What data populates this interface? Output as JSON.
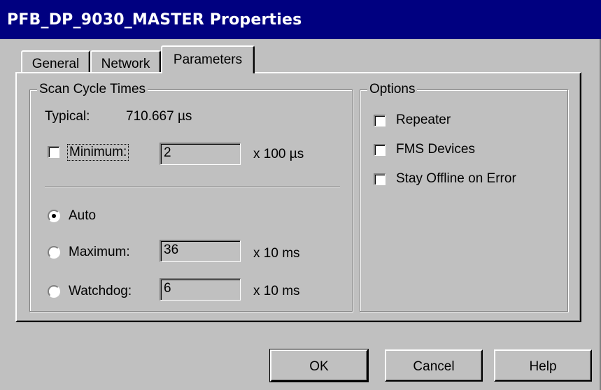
{
  "window": {
    "title": "PFB_DP_9030_MASTER Properties"
  },
  "tabs": [
    {
      "label": "General",
      "active": false
    },
    {
      "label": "Network",
      "active": false
    },
    {
      "label": "Parameters",
      "active": true
    }
  ],
  "scan_cycle": {
    "legend": "Scan Cycle Times",
    "typical_label": "Typical:",
    "typical_value": "710.667 µs",
    "minimum": {
      "label": "Minimum:",
      "checked": false,
      "value": "2",
      "unit": "x 100 µs"
    },
    "auto": {
      "label": "Auto",
      "selected": true
    },
    "maximum": {
      "label": "Maximum:",
      "selected": false,
      "value": "36",
      "unit": "x 10 ms"
    },
    "watchdog": {
      "label": "Watchdog:",
      "selected": false,
      "value": "6",
      "unit": "x 10 ms"
    }
  },
  "options": {
    "legend": "Options",
    "items": [
      {
        "label": "Repeater",
        "checked": false
      },
      {
        "label": "FMS Devices",
        "checked": false
      },
      {
        "label": "Stay Offline on Error",
        "checked": false
      }
    ]
  },
  "buttons": {
    "ok": "OK",
    "cancel": "Cancel",
    "help": "Help"
  },
  "colors": {
    "title_bar": "#000080",
    "dialog_face": "#c0c0c0"
  }
}
